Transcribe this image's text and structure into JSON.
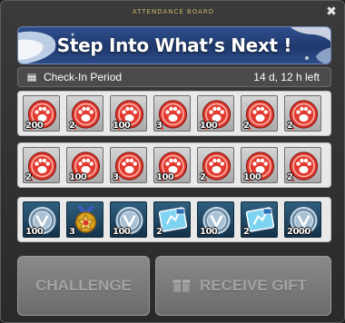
{
  "window": {
    "title": "ATTENDANCE BOARD",
    "close_glyph": "✖"
  },
  "banner": {
    "title": "Step Into What’s Next !"
  },
  "period": {
    "label": "Check-In Period",
    "time_left": "14 d, 12 h left",
    "icon": "calendar-icon"
  },
  "rows": [
    {
      "items": [
        {
          "icon": "red-paw-icon",
          "qty": "200"
        },
        {
          "icon": "red-paw-icon",
          "qty": "2"
        },
        {
          "icon": "red-paw-icon",
          "qty": "100"
        },
        {
          "icon": "red-paw-icon",
          "qty": "3"
        },
        {
          "icon": "red-paw-icon",
          "qty": "100"
        },
        {
          "icon": "red-paw-icon",
          "qty": "2"
        },
        {
          "icon": "red-paw-icon",
          "qty": "2"
        }
      ]
    },
    {
      "items": [
        {
          "icon": "red-paw-icon",
          "qty": "2"
        },
        {
          "icon": "red-paw-icon",
          "qty": "100"
        },
        {
          "icon": "red-paw-icon",
          "qty": "3"
        },
        {
          "icon": "red-paw-icon",
          "qty": "100"
        },
        {
          "icon": "red-paw-icon",
          "qty": "2"
        },
        {
          "icon": "red-paw-icon",
          "qty": "100"
        },
        {
          "icon": "red-paw-icon",
          "qty": "2"
        }
      ]
    },
    {
      "items": [
        {
          "icon": "v-coin-icon",
          "qty": "100"
        },
        {
          "icon": "gold-medal-icon",
          "qty": "3"
        },
        {
          "icon": "v-coin-icon",
          "qty": "100"
        },
        {
          "icon": "blue-ticket-icon",
          "qty": "2"
        },
        {
          "icon": "v-coin-icon",
          "qty": "100"
        },
        {
          "icon": "blue-ticket-icon",
          "qty": "2"
        },
        {
          "icon": "v-coin-icon",
          "qty": "2000"
        }
      ]
    }
  ],
  "buttons": {
    "challenge": "CHALLENGE",
    "receive_gift": "RECEIVE GIFT"
  },
  "colors": {
    "accent_gold": "#c9b46a",
    "banner_blue": "#2e4f8d",
    "paw_red": "#e03a2f"
  }
}
